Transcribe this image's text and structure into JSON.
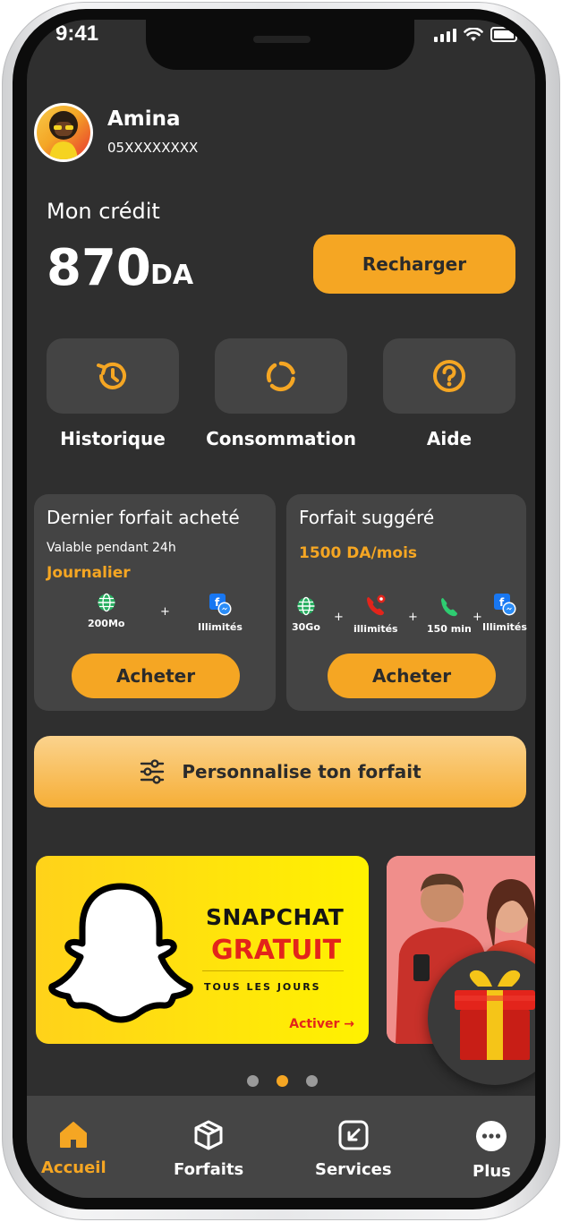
{
  "status_bar": {
    "time": "9:41"
  },
  "user": {
    "name": "Amina",
    "phone": "05XXXXXXXX"
  },
  "credit": {
    "label": "Mon crédit",
    "amount": "870",
    "currency": "DA",
    "recharge_label": "Recharger"
  },
  "quick_actions": [
    {
      "label": "Historique",
      "icon": "history-icon"
    },
    {
      "label": "Consommation",
      "icon": "consumption-icon"
    },
    {
      "label": "Aide",
      "icon": "help-icon"
    }
  ],
  "last_plan": {
    "title": "Dernier forfait acheté",
    "validity": "Valable pendant 24h",
    "type": "Journalier",
    "features": [
      {
        "label": "200Mo",
        "icon": "globe-icon"
      },
      {
        "label": "Illimités",
        "icon": "social-icon"
      }
    ],
    "buy_label": "Acheter"
  },
  "suggested_plan": {
    "title": "Forfait suggéré",
    "price": "1500 DA/mois",
    "features": [
      {
        "label": "30Go",
        "icon": "globe-icon"
      },
      {
        "label": "illimités",
        "icon": "phone-red-icon"
      },
      {
        "label": "150 min",
        "icon": "phone-green-icon"
      },
      {
        "label": "Illimités",
        "icon": "social-icon"
      }
    ],
    "buy_label": "Acheter"
  },
  "customize": {
    "label": "Personnalise ton forfait",
    "icon": "sliders-icon"
  },
  "promo": {
    "title1": "SNAPCHAT",
    "title2": "GRATUIT",
    "subtitle": "TOUS LES JOURS",
    "cta": "Activer →"
  },
  "carousel": {
    "count": 3,
    "active_index": 1
  },
  "nav": [
    {
      "label": "Accueil",
      "icon": "home-icon",
      "active": true
    },
    {
      "label": "Forfaits",
      "icon": "box-icon",
      "active": false
    },
    {
      "label": "Services",
      "icon": "services-icon",
      "active": false
    },
    {
      "label": "Plus",
      "icon": "more-icon",
      "active": false
    }
  ],
  "colors": {
    "accent": "#f5a623",
    "background": "#2f2f2f",
    "card": "#444444",
    "promo_red": "#e3241b"
  }
}
